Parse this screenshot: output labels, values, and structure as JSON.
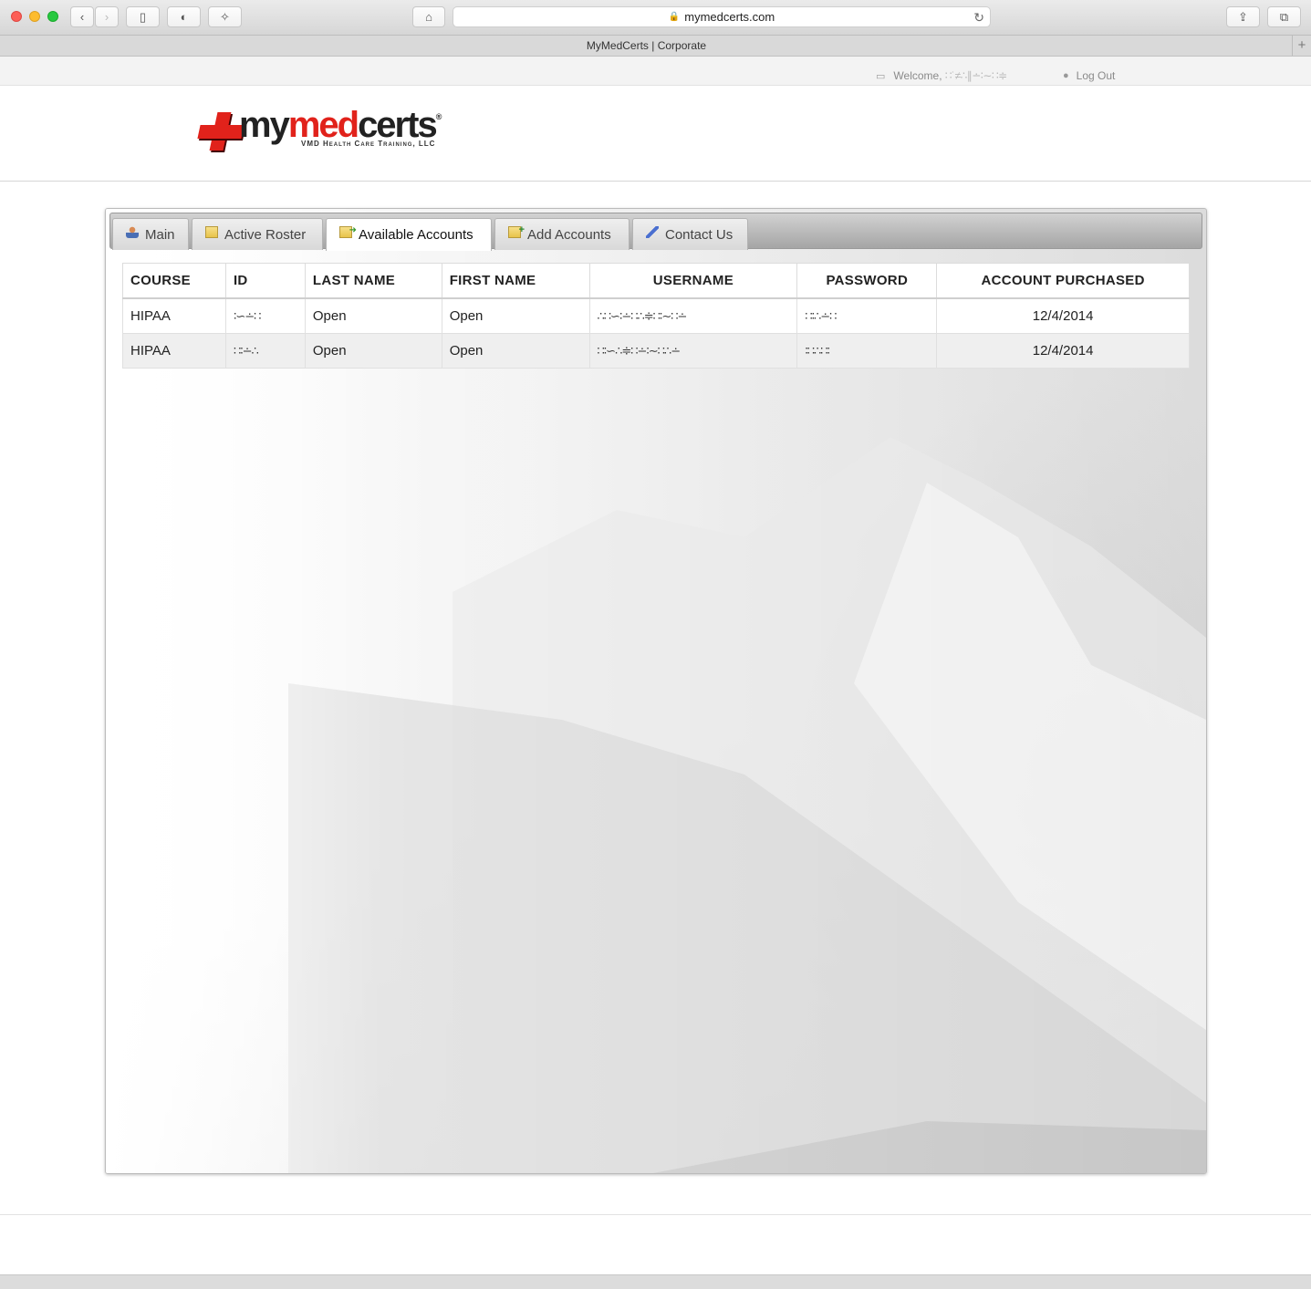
{
  "browser": {
    "url": "mymedcerts.com",
    "tab_title": "MyMedCerts | Corporate"
  },
  "header": {
    "welcome_label": "Welcome,",
    "welcome_name": "∷˙≠∴∥∸∶∼∷≑",
    "logout_label": "Log Out"
  },
  "logo": {
    "part1": "my",
    "part2": "med",
    "part3": "certs",
    "reg": "®",
    "tagline": "VMD Health Care Training, LLC"
  },
  "tabs": [
    {
      "label": "Main",
      "icon": "user-icon"
    },
    {
      "label": "Active Roster",
      "icon": "folder-icon"
    },
    {
      "label": "Available Accounts",
      "icon": "folder-arrow-icon",
      "active": true
    },
    {
      "label": "Add Accounts",
      "icon": "folder-add-icon"
    },
    {
      "label": "Contact Us",
      "icon": "pen-icon"
    }
  ],
  "table": {
    "headers": [
      "COURSE",
      "ID",
      "LAST NAME",
      "FIRST NAME",
      "USERNAME",
      "PASSWORD",
      "ACCOUNT PURCHASED"
    ],
    "rows": [
      {
        "course": "HIPAA",
        "id": "∶∽∸∷",
        "last": "Open",
        "first": "Open",
        "username": "∴∷∽∶∸∷∴≑∷∶∼∷∸",
        "password": "∷∶∴∸∷",
        "purchased": "12/4/2014"
      },
      {
        "course": "HIPAA",
        "id": "∷∶∸∴",
        "last": "Open",
        "first": "Open",
        "username": "∷∶∽∴≑∷∸∶∼∷∴∸",
        "password": "∶∷∴∷∶",
        "purchased": "12/4/2014"
      }
    ]
  },
  "colors": {
    "brand_red": "#e1221b",
    "tab_active_bg": "#ffffff"
  }
}
